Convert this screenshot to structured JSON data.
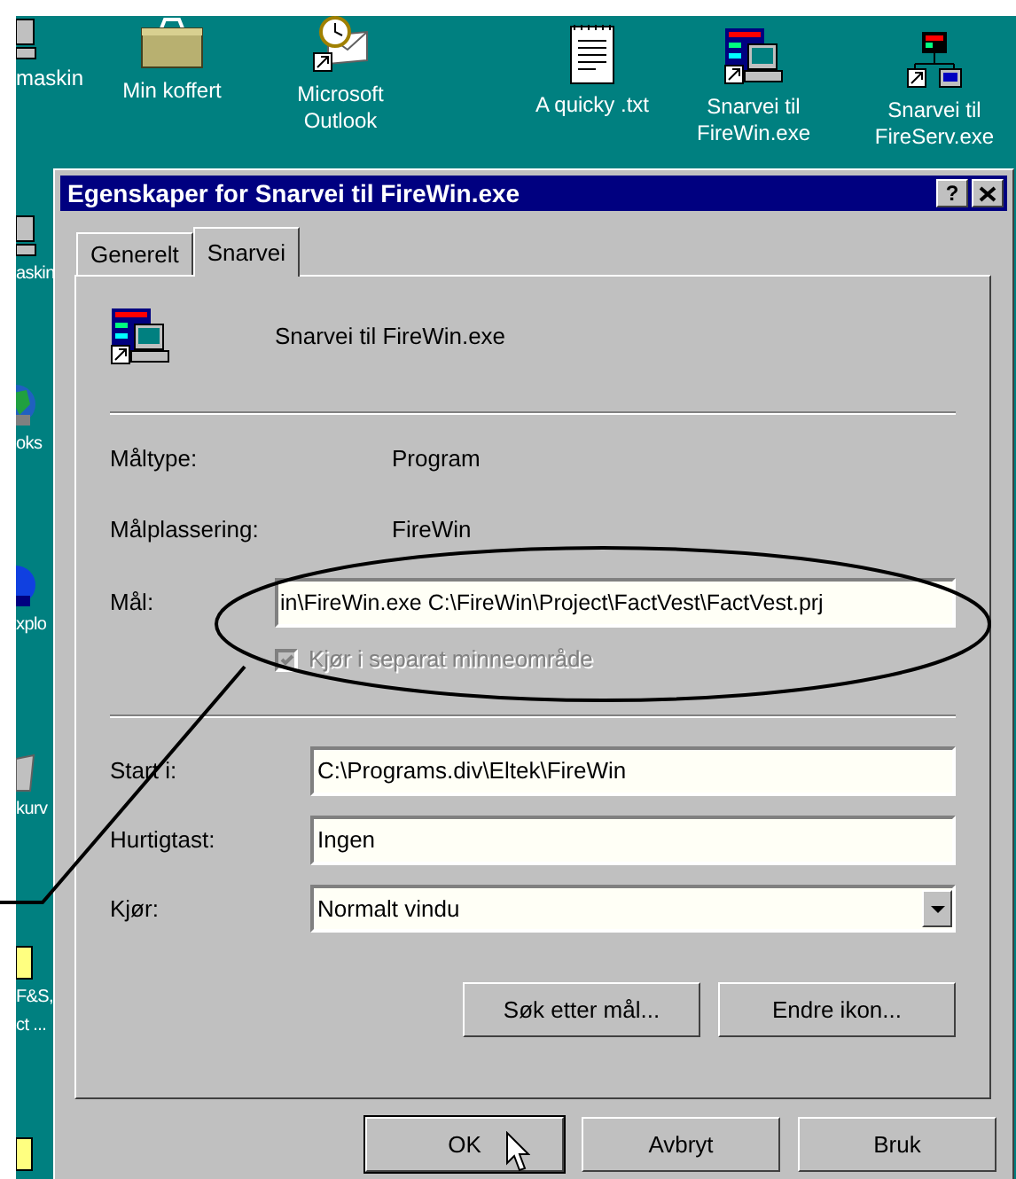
{
  "desktop_left": [
    {
      "kind": "computer",
      "lines": [
        "maskin"
      ]
    },
    {
      "kind": "computer",
      "lines": [
        "askin"
      ]
    },
    {
      "kind": "globe",
      "lines": [
        "oks"
      ]
    },
    {
      "kind": "explorer",
      "lines": [
        "xplo"
      ]
    },
    {
      "kind": "trash",
      "lines": [
        "kurv"
      ]
    },
    {
      "kind": "folder",
      "lines": [
        "F&S,",
        "ct ..."
      ]
    },
    {
      "kind": "folder"
    }
  ],
  "desktop_icons": [
    {
      "kind": "briefcase",
      "lines": [
        "Min koffert"
      ]
    },
    {
      "kind": "outlook",
      "lines": [
        "Microsoft",
        "Outlook"
      ]
    },
    {
      "kind": "notepad",
      "lines": [
        "A quicky .txt"
      ]
    },
    {
      "kind": "firewin",
      "lines": [
        "Snarvei til",
        "FireWin.exe"
      ]
    },
    {
      "kind": "fireserv",
      "lines": [
        "Snarvei til",
        "FireServ.exe"
      ]
    }
  ],
  "dialog": {
    "title": "Egenskaper for Snarvei til FireWin.exe",
    "help": "?",
    "tabs": [
      {
        "label": "Generelt",
        "selected": false
      },
      {
        "label": "Snarvei",
        "selected": true
      }
    ],
    "header": "Snarvei til FireWin.exe",
    "info": [
      {
        "label": "Måltype:",
        "value": "Program"
      },
      {
        "label": "Målplassering:",
        "value": "FireWin"
      }
    ],
    "target": {
      "label": "Mål:",
      "value": "in\\FireWin.exe C:\\FireWin\\Project\\FactVest\\FactVest.prj"
    },
    "checkbox": {
      "label": "Kjør i separat minneområde",
      "checked": true,
      "disabled": true
    },
    "fields": [
      {
        "kind": "text",
        "label": "Start i:",
        "value": "C:\\Programs.div\\Eltek\\FireWin"
      },
      {
        "kind": "text",
        "label": "Hurtigtast:",
        "value": "Ingen"
      },
      {
        "kind": "dropdown",
        "label": "Kjør:",
        "value": "Normalt vindu"
      }
    ],
    "panel_buttons": [
      "Søk etter mål...",
      "Endre ikon..."
    ],
    "footer_buttons": [
      {
        "label": "OK",
        "default": true
      },
      {
        "label": "Avbryt",
        "default": false
      },
      {
        "label": "Bruk",
        "default": false
      }
    ]
  }
}
